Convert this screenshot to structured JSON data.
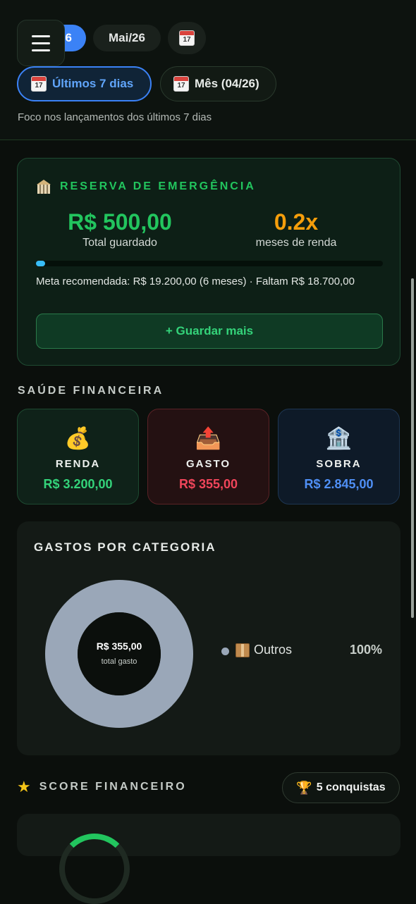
{
  "header": {
    "period_pill_partial": "6",
    "month_pill": "Mai/26",
    "calendar_day": "17",
    "range_active": "Últimos 7 dias",
    "range_other": "Mês (04/26)",
    "focus_text": "Foco nos lançamentos dos últimos 7 dias"
  },
  "emergency": {
    "title": "RESERVA DE EMERGÊNCIA",
    "saved_value": "R$ 500,00",
    "saved_label": "Total guardado",
    "months_value": "0.2x",
    "months_label": "meses de renda",
    "progress_fraction": 0.026,
    "meta_text": "Meta recomendada: R$ 19.200,00 (6 meses) · Faltam R$ 18.700,00",
    "save_more_button": "+ Guardar mais"
  },
  "health": {
    "title": "SAÚDE FINANCEIRA",
    "cards": [
      {
        "label": "RENDA",
        "value": "R$ 3.200,00",
        "color": "#34d37a",
        "emoji": "💰"
      },
      {
        "label": "GASTO",
        "value": "R$ 355,00",
        "color": "#f0455a",
        "emoji": "📤"
      },
      {
        "label": "SOBRA",
        "value": "R$ 2.845,00",
        "color": "#4f8ff5",
        "emoji": "🏦"
      }
    ]
  },
  "categories": {
    "title": "GASTOS POR CATEGORIA",
    "center_value": "R$ 355,00",
    "center_label": "total gasto",
    "legend": [
      {
        "name": "Outros",
        "percent": "100%",
        "color": "#9aa7b8"
      }
    ]
  },
  "score": {
    "title": "SCORE FINANCEIRO",
    "achievements": "5 conquistas"
  }
}
